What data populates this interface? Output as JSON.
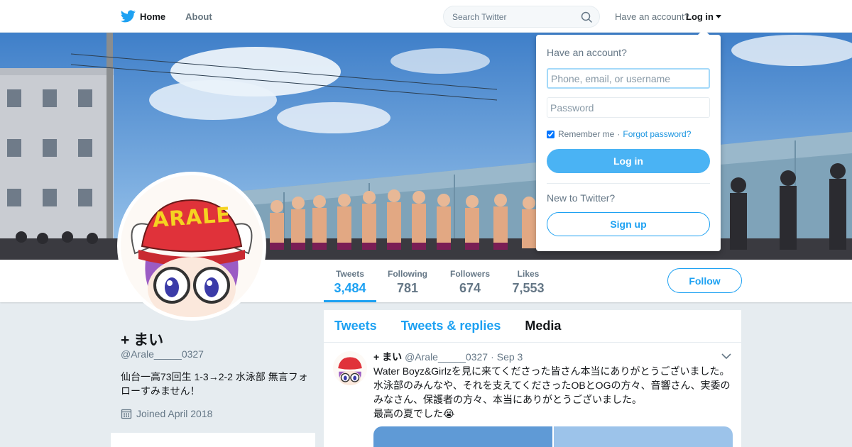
{
  "topnav": {
    "home_label": "Home",
    "about_label": "About",
    "search_placeholder": "Search Twitter",
    "have_account_label": "Have an account?",
    "login_label": "Log in"
  },
  "login_dropdown": {
    "title": "Have an account?",
    "username_placeholder": "Phone, email, or username",
    "password_placeholder": "Password",
    "remember_label": "Remember me",
    "separator": "·",
    "forgot_label": "Forgot password?",
    "login_button": "Log in",
    "new_label": "New to Twitter?",
    "signup_button": "Sign up",
    "remember_checked": true
  },
  "profile": {
    "name": "+ まい",
    "handle": "@Arale_____0327",
    "bio": "仙台一高73回生 1-3→2-2 水泳部 無言フォローすみません！",
    "joined": "Joined April 2018",
    "avatar_text": "ARALE"
  },
  "stats": [
    {
      "label": "Tweets",
      "value": "3,484"
    },
    {
      "label": "Following",
      "value": "781"
    },
    {
      "label": "Followers",
      "value": "674"
    },
    {
      "label": "Likes",
      "value": "7,553"
    }
  ],
  "follow_button": "Follow",
  "timeline": {
    "tabs": [
      "Tweets",
      "Tweets & replies",
      "Media"
    ],
    "active_tab": "Media"
  },
  "tweet": {
    "name": "+ まい",
    "handle": "@Arale_____0327",
    "dot": "·",
    "time": "Sep 3",
    "lines": [
      "Water Boyz&Girlzを見に来てくださった皆さん本当にありがとうございました。",
      "水泳部のみんなや、それを支えてくださったOBとOGの方々、音響さん、実委のみなさん、保護者の方々、本当にありがとうございました。",
      "最高の夏でした😭"
    ]
  },
  "colors": {
    "brand_blue": "#1da1f2",
    "login_button": "#4ab3f4",
    "text_secondary": "#657786",
    "page_background": "#e6ecf0"
  },
  "icons": [
    "twitter-bird-icon",
    "search-icon",
    "chevron-down-icon",
    "calendar-icon"
  ]
}
